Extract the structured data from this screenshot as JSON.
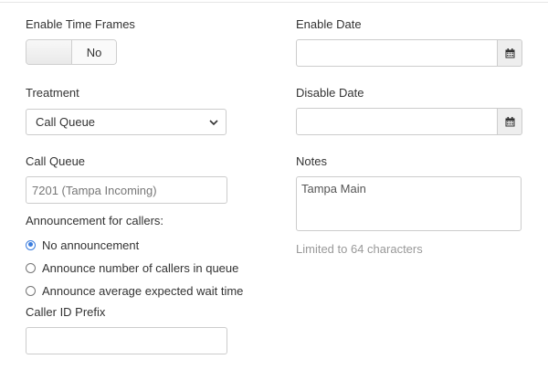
{
  "form": {
    "enable_time_frames": {
      "label": "Enable Time Frames",
      "toggle_value": "No"
    },
    "treatment": {
      "label": "Treatment",
      "selected": "Call Queue"
    },
    "call_queue": {
      "label": "Call Queue",
      "value": "7201 (Tampa Incoming)"
    },
    "announcement": {
      "label": "Announcement for callers:",
      "options": [
        {
          "label": "No announcement",
          "checked": true
        },
        {
          "label": "Announce number of callers in queue",
          "checked": false
        },
        {
          "label": "Announce average expected wait time",
          "checked": false
        }
      ]
    },
    "caller_id_prefix": {
      "label": "Caller ID Prefix",
      "value": ""
    },
    "enable_date": {
      "label": "Enable Date",
      "value": "",
      "icon": "calendar-icon"
    },
    "disable_date": {
      "label": "Disable Date",
      "value": "",
      "icon": "calendar-icon"
    },
    "notes": {
      "label": "Notes",
      "value": "Tampa Main",
      "hint": "Limited to 64 characters"
    }
  },
  "colors": {
    "radio_accent": "#3b7ddd",
    "hint_text": "#999999",
    "border": "#cccccc"
  }
}
